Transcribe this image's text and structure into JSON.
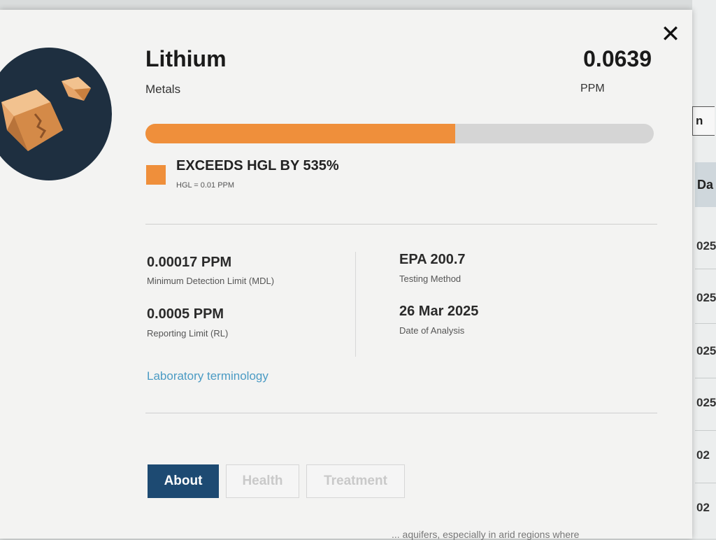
{
  "background_page": {
    "button_label": "n",
    "column_header": "Da",
    "cells": [
      "025",
      "025",
      "025",
      "025",
      "02",
      "02"
    ]
  },
  "modal": {
    "close_label": "✕",
    "avatar_icon": "rock-icon",
    "contaminant": {
      "name": "Lithium",
      "category": "Metals",
      "value": "0.0639",
      "unit": "PPM",
      "level_fraction": 0.61,
      "status": "EXCEEDS HGL BY 535%",
      "hgl_note": "HGL = 0.01 PPM",
      "status_color": "#ef8f3b"
    },
    "stats": {
      "mdl_value": "0.00017 PPM",
      "mdl_label": "Minimum Detection Limit (MDL)",
      "rl_value": "0.0005 PPM",
      "rl_label": "Reporting Limit (RL)",
      "method_value": "EPA 200.7",
      "method_label": "Testing Method",
      "date_value": "26 Mar 2025",
      "date_label": "Date of Analysis"
    },
    "link_label": "Laboratory terminology",
    "tabs": [
      {
        "label": "About",
        "active": true
      },
      {
        "label": "Health",
        "active": false
      },
      {
        "label": "Treatment",
        "active": false
      }
    ],
    "footer_partial_text": "... aquifers, especially in arid regions where"
  }
}
